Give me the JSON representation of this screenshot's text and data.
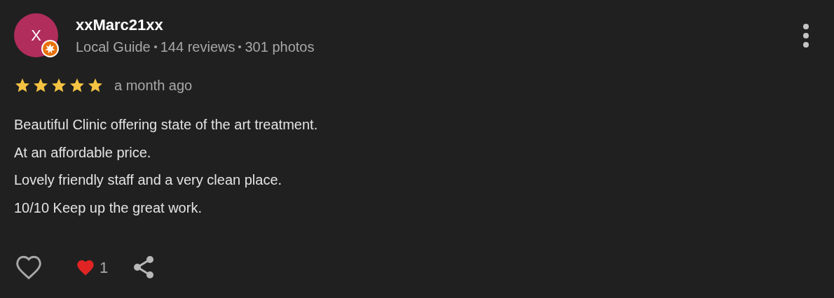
{
  "review": {
    "avatar_letter": "X",
    "local_guide_badge": true,
    "author": "xxMarc21xx",
    "meta": [
      "Local Guide",
      "144 reviews",
      "301 photos"
    ],
    "stars": 5,
    "time": "a month ago",
    "lines": [
      "Beautiful Clinic offering state of the art treatment.",
      "At an affordable price.",
      "Lovely friendly staff and a very clean place.",
      "10/10 Keep up the great work."
    ],
    "liked": false,
    "reaction_count": "1"
  }
}
